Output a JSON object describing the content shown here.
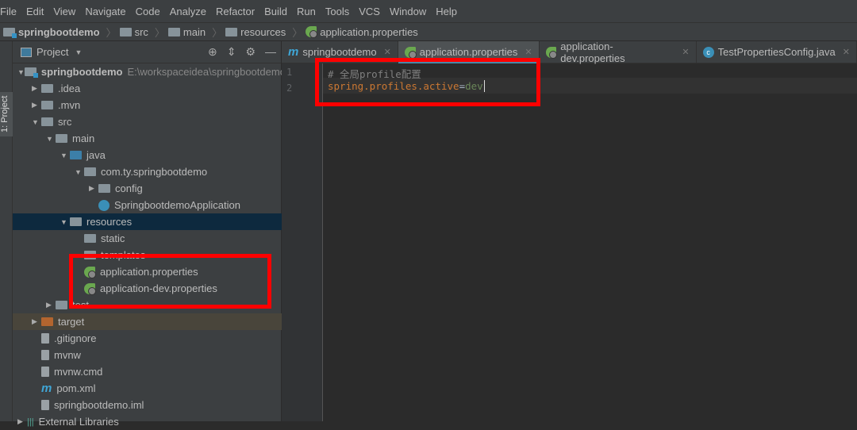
{
  "menu": [
    "File",
    "Edit",
    "View",
    "Navigate",
    "Code",
    "Analyze",
    "Refactor",
    "Build",
    "Run",
    "Tools",
    "VCS",
    "Window",
    "Help"
  ],
  "breadcrumb": [
    "springbootdemo",
    "src",
    "main",
    "resources",
    "application.properties"
  ],
  "left_stripe": "1: Project",
  "panel": {
    "title": "Project"
  },
  "tree": [
    {
      "label": "springbootdemo",
      "path": "E:\\workspaceidea\\springbootdemo",
      "level": 0,
      "arrow": "down",
      "icon": "module-folder"
    },
    {
      "label": ".idea",
      "level": 1,
      "arrow": "right",
      "icon": "folder"
    },
    {
      "label": ".mvn",
      "level": 1,
      "arrow": "right",
      "icon": "folder"
    },
    {
      "label": "src",
      "level": 1,
      "arrow": "down",
      "icon": "folder"
    },
    {
      "label": "main",
      "level": 2,
      "arrow": "down",
      "icon": "folder"
    },
    {
      "label": "java",
      "level": 3,
      "arrow": "down",
      "icon": "source-folder"
    },
    {
      "label": "com.ty.springbootdemo",
      "level": 4,
      "arrow": "down",
      "icon": "package"
    },
    {
      "label": "config",
      "level": 5,
      "arrow": "right",
      "icon": "package"
    },
    {
      "label": "SpringbootdemoApplication",
      "level": 5,
      "arrow": "",
      "icon": "spring-boot-class"
    },
    {
      "label": "resources",
      "level": 3,
      "arrow": "down",
      "icon": "resources-folder",
      "selected": true
    },
    {
      "label": "static",
      "level": 4,
      "arrow": "",
      "icon": "folder"
    },
    {
      "label": "templates",
      "level": 4,
      "arrow": "",
      "icon": "folder"
    },
    {
      "label": "application.properties",
      "level": 4,
      "arrow": "",
      "icon": "spring"
    },
    {
      "label": "application-dev.properties",
      "level": 4,
      "arrow": "",
      "icon": "spring"
    },
    {
      "label": "test",
      "level": 2,
      "arrow": "right",
      "icon": "folder"
    },
    {
      "label": "target",
      "level": 1,
      "arrow": "right",
      "icon": "excluded-folder",
      "highlight": true
    },
    {
      "label": ".gitignore",
      "level": 1,
      "arrow": "",
      "icon": "file"
    },
    {
      "label": "mvnw",
      "level": 1,
      "arrow": "",
      "icon": "file"
    },
    {
      "label": "mvnw.cmd",
      "level": 1,
      "arrow": "",
      "icon": "file"
    },
    {
      "label": "pom.xml",
      "level": 1,
      "arrow": "",
      "icon": "maven"
    },
    {
      "label": "springbootdemo.iml",
      "level": 1,
      "arrow": "",
      "icon": "file"
    },
    {
      "label": "External Libraries",
      "level": 0,
      "arrow": "right",
      "icon": "library"
    }
  ],
  "tabs": [
    {
      "label": "springbootdemo",
      "icon": "maven"
    },
    {
      "label": "application.properties",
      "icon": "spring",
      "active": true
    },
    {
      "label": "application-dev.properties",
      "icon": "spring"
    },
    {
      "label": "TestPropertiesConfig.java",
      "icon": "class"
    }
  ],
  "editor": {
    "lines": [
      {
        "n": "1",
        "comment": "# 全局profile配置"
      },
      {
        "n": "2",
        "key": "spring.profiles.active",
        "eq": "=",
        "value": "dev"
      }
    ]
  },
  "colors": {
    "highlight_box": "#ff0000",
    "key": "#cc7832",
    "value": "#6a8759",
    "comment": "#808080"
  }
}
